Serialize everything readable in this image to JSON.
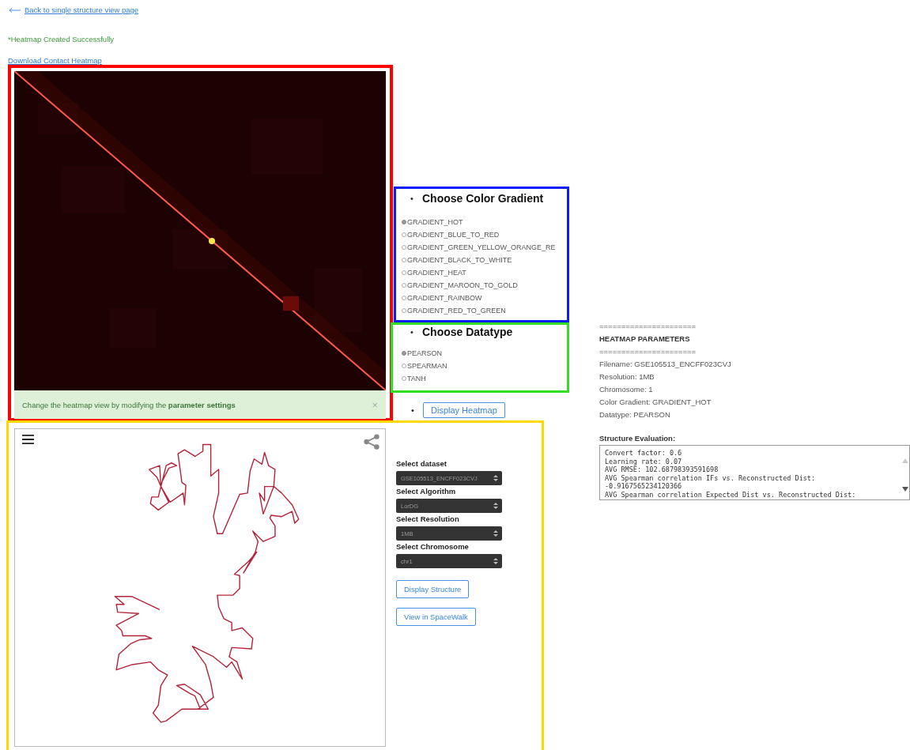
{
  "header": {
    "back_link": "Back to single structure view page",
    "status": "*Heatmap Created Successfully",
    "download_link": "Download Contact Heatmap"
  },
  "heatmap": {
    "alert": {
      "text": "Change the heatmap view by modifying the **parameter settings**",
      "close": "×"
    }
  },
  "color_gradient": {
    "bullet": "•",
    "heading": "Choose Color Gradient",
    "options": [
      {
        "label": "GRADIENT_HOT",
        "selected": true
      },
      {
        "label": "GRADIENT_BLUE_TO_RED",
        "selected": false
      },
      {
        "label": "GRADIENT_GREEN_YELLOW_ORANGE_RE",
        "selected": false
      },
      {
        "label": "GRADIENT_BLACK_TO_WHITE",
        "selected": false
      },
      {
        "label": "GRADIENT_HEAT",
        "selected": false
      },
      {
        "label": "GRADIENT_MAROON_TO_GOLD",
        "selected": false
      },
      {
        "label": "GRADIENT_RAINBOW",
        "selected": false
      },
      {
        "label": "GRADIENT_RED_TO_GREEN",
        "selected": false
      }
    ]
  },
  "datatype": {
    "bullet": "•",
    "heading": "Choose Datatype",
    "options": [
      {
        "label": "PEARSON",
        "selected": true
      },
      {
        "label": "SPEARMAN",
        "selected": false
      },
      {
        "label": "TANH",
        "selected": false
      }
    ]
  },
  "display_heatmap": {
    "bullet": "•",
    "button": "Display Heatmap"
  },
  "structure_controls": {
    "selects": [
      {
        "label": "Select dataset",
        "value": "GSE105513_ENCFF023CVJ"
      },
      {
        "label": "Select Algorithm",
        "value": "LorDG"
      },
      {
        "label": "Select Resolution",
        "value": "1MB"
      },
      {
        "label": "Select Chromosome",
        "value": "chr1"
      }
    ],
    "buttons": [
      "Display Structure",
      "View in SpaceWalk"
    ]
  },
  "parameters": {
    "lines": [
      {
        "text": "======================",
        "kind": "rule"
      },
      {
        "text": "HEATMAP PARAMETERS",
        "kind": "title"
      },
      {
        "text": "======================",
        "kind": "rule"
      },
      {
        "text": "Filename: GSE105513_ENCFF023CVJ",
        "kind": "value"
      },
      {
        "text": "Resolution: 1MB",
        "kind": "value"
      },
      {
        "text": "Chromosome: 1",
        "kind": "value"
      },
      {
        "text": "Color Gradient: GRADIENT_HOT",
        "kind": "value"
      },
      {
        "text": "Datatype: PEARSON",
        "kind": "value"
      }
    ]
  },
  "evaluation": {
    "heading": "Structure Evaluation:",
    "lines": [
      "Convert factor: 0.6",
      "Learning rate: 0.07",
      "AVG RMSE: 102.68798393591698",
      "AVG Spearman correlation IFs vs. Reconstructed Dist:",
      "-0.9167565234120366",
      "AVG Spearman correlation Expected Dist vs. Reconstructed Dist:"
    ]
  }
}
